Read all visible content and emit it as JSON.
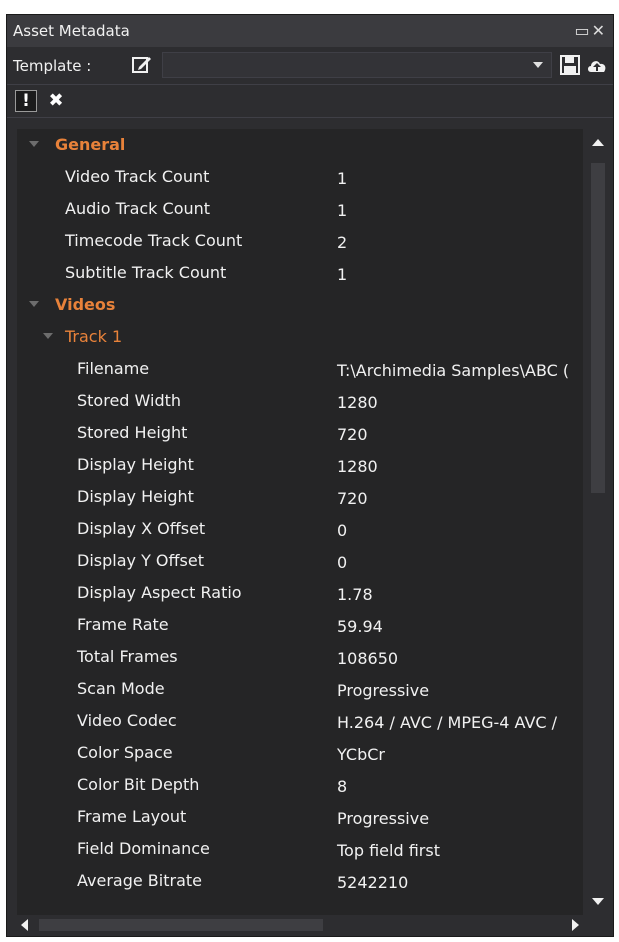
{
  "window": {
    "title": "Asset Metadata"
  },
  "template": {
    "label": "Template :"
  },
  "general": {
    "label": "General",
    "items": [
      {
        "key": "Video Track Count",
        "value": "1"
      },
      {
        "key": "Audio Track Count",
        "value": "1"
      },
      {
        "key": "Timecode Track Count",
        "value": "2"
      },
      {
        "key": "Subtitle Track Count",
        "value": "1"
      }
    ]
  },
  "videos": {
    "label": "Videos",
    "track": {
      "label": "Track 1",
      "items": [
        {
          "key": "Filename",
          "value": "T:\\Archimedia Samples\\ABC ("
        },
        {
          "key": "Stored Width",
          "value": "1280"
        },
        {
          "key": "Stored Height",
          "value": "720"
        },
        {
          "key": "Display Height",
          "value": "1280"
        },
        {
          "key": "Display Height",
          "value": "720"
        },
        {
          "key": "Display X Offset",
          "value": "0"
        },
        {
          "key": "Display Y Offset",
          "value": "0"
        },
        {
          "key": "Display Aspect Ratio",
          "value": "1.78"
        },
        {
          "key": "Frame Rate",
          "value": "59.94"
        },
        {
          "key": "Total Frames",
          "value": "108650"
        },
        {
          "key": "Scan Mode",
          "value": "Progressive"
        },
        {
          "key": "Video Codec",
          "value": "H.264 / AVC / MPEG-4 AVC /"
        },
        {
          "key": "Color Space",
          "value": "YCbCr"
        },
        {
          "key": "Color Bit Depth",
          "value": "8"
        },
        {
          "key": "Frame Layout",
          "value": "Progressive"
        },
        {
          "key": "Field Dominance",
          "value": "Top field first"
        },
        {
          "key": "Average Bitrate",
          "value": "5242210"
        }
      ]
    }
  },
  "colors": {
    "group_header": "#e8823a",
    "background": "#2d2d30",
    "text": "#f1f1f1"
  }
}
